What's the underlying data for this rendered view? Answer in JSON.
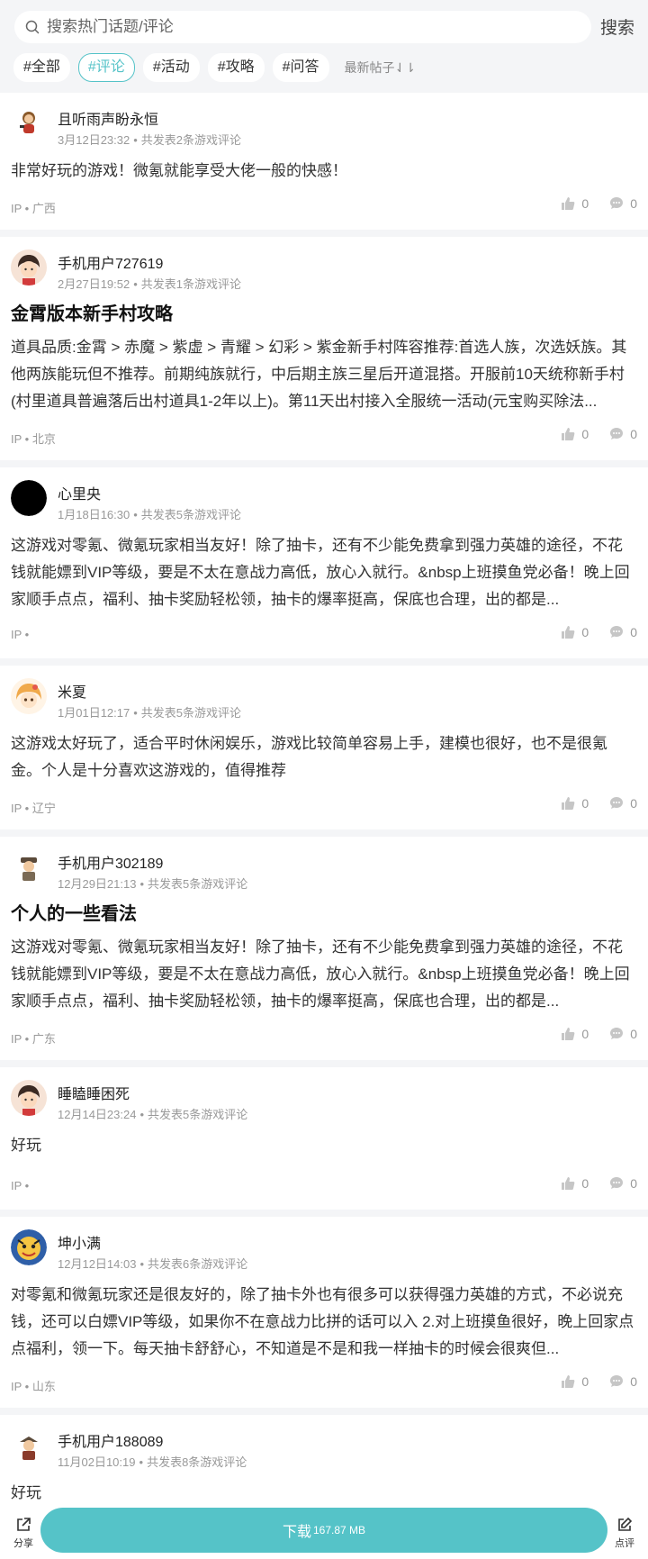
{
  "search": {
    "placeholder": "搜索热门话题/评论",
    "button_label": "搜索"
  },
  "tabs": [
    "#全部",
    "#评论",
    "#活动",
    "#攻略",
    "#问答"
  ],
  "active_tab": "#评论",
  "sort_label": "最新帖子⇃⇂",
  "like_icon": "thumb-up-icon",
  "comment_icon": "comment-icon",
  "posts": [
    {
      "username": "且听雨声盼永恒",
      "date": "3月12日23:32",
      "post_count": "共发表2条游戏评论",
      "title": "",
      "body": "非常好玩的游戏！微氪就能享受大佬一般的快感！",
      "ip": "IP • 广西",
      "likes": "0",
      "comments": "0"
    },
    {
      "username": "手机用户727619",
      "date": "2月27日19:52",
      "post_count": "共发表1条游戏评论",
      "title": "金霄版本新手村攻略",
      "body": "道具品质:金霄 > 赤魔 > 紫虚 > 青耀 > 幻彩 > 紫金新手村阵容推荐:首选人族，次选妖族。其他两族能玩但不推荐。前期纯族就行，中后期主族三星后开道混搭。开服前10天统称新手村(村里道具普遍落后出村道具1-2年以上)。第11天出村接入全服统一活动(元宝购买除法...",
      "ip": "IP • 北京",
      "likes": "0",
      "comments": "0"
    },
    {
      "username": "心里央",
      "date": "1月18日16:30",
      "post_count": "共发表5条游戏评论",
      "title": "",
      "body": "这游戏对零氪、微氪玩家相当友好！除了抽卡，还有不少能免费拿到强力英雄的途径，不花钱就能嫖到VIP等级，要是不太在意战力高低，放心入就行。&nbsp上班摸鱼党必备！晚上回家顺手点点，福利、抽卡奖励轻松领，抽卡的爆率挺高，保底也合理，出的都是...",
      "ip": "IP •",
      "likes": "0",
      "comments": "0"
    },
    {
      "username": "米夏",
      "date": "1月01日12:17",
      "post_count": "共发表5条游戏评论",
      "title": "",
      "body": "这游戏太好玩了，适合平时休闲娱乐，游戏比较简单容易上手，建模也很好，也不是很氪金。个人是十分喜欢这游戏的，值得推荐",
      "ip": "IP • 辽宁",
      "likes": "0",
      "comments": "0"
    },
    {
      "username": "手机用户302189",
      "date": "12月29日21:13",
      "post_count": "共发表5条游戏评论",
      "title": "个人的一些看法",
      "body": "这游戏对零氪、微氪玩家相当友好！除了抽卡，还有不少能免费拿到强力英雄的途径，不花钱就能嫖到VIP等级，要是不太在意战力高低，放心入就行。&nbsp上班摸鱼党必备！晚上回家顺手点点，福利、抽卡奖励轻松领，抽卡的爆率挺高，保底也合理，出的都是...",
      "ip": "IP • 广东",
      "likes": "0",
      "comments": "0"
    },
    {
      "username": "睡瞌睡困死",
      "date": "12月14日23:24",
      "post_count": "共发表5条游戏评论",
      "title": "",
      "body": "好玩",
      "ip": "IP •",
      "likes": "0",
      "comments": "0"
    },
    {
      "username": "坤小满",
      "date": "12月12日14:03",
      "post_count": "共发表6条游戏评论",
      "title": "",
      "body": "对零氪和微氪玩家还是很友好的，除了抽卡外也有很多可以获得强力英雄的方式，不必说充钱，还可以白嫖VIP等级，如果你不在意战力比拼的话可以入 2.对上班摸鱼很好，晚上回家点点福利，领一下。每天抽卡舒舒心，不知道是不是和我一样抽卡的时候会很爽但...",
      "ip": "IP • 山东",
      "likes": "0",
      "comments": "0"
    },
    {
      "username": "手机用户188089",
      "date": "11月02日10:19",
      "post_count": "共发表8条游戏评论",
      "title": "",
      "body": "好玩",
      "ip": "",
      "likes": "",
      "comments": ""
    }
  ],
  "bottom": {
    "share_label": "分享",
    "download_label": "下载",
    "download_size": "167.87 MB",
    "review_label": "点评"
  }
}
